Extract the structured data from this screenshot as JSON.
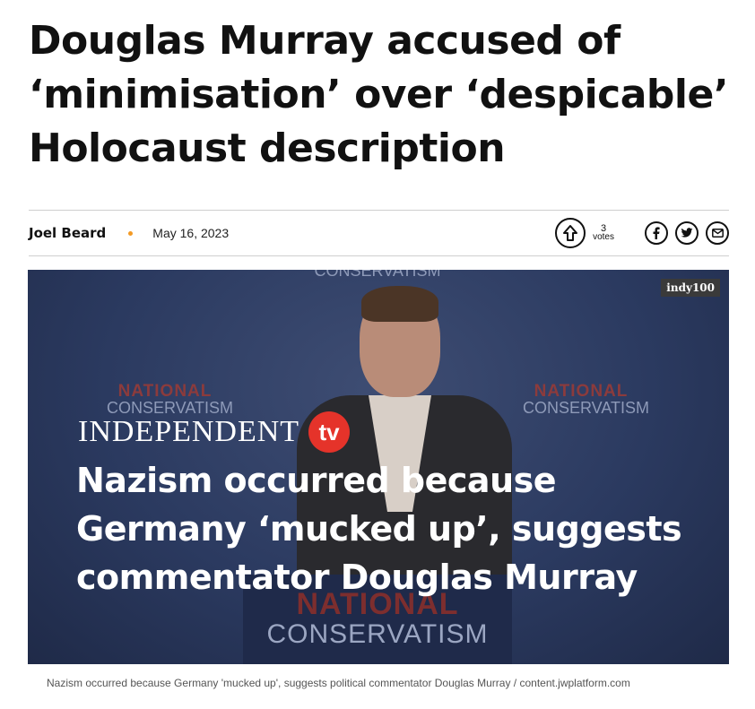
{
  "article": {
    "headline": "Douglas Murray accused of ‘minimisation’ over ‘despicable’ Holocaust description",
    "author": "Joel Beard",
    "date": "May 16, 2023",
    "votes_count": "3",
    "votes_label": "votes"
  },
  "share_icons": [
    "facebook-icon",
    "twitter-icon",
    "email-icon"
  ],
  "media": {
    "badge": "indy100",
    "brand_word": "INDEPENDENT",
    "brand_tv": "tv",
    "overlay_title": "Nazism occurred because Germany ‘mucked up’, suggests commentator Douglas Murray",
    "backdrop_top": "CONSERVATISM",
    "backdrop_line1": "NATIONAL",
    "backdrop_line2": "CONSERVATISM"
  },
  "caption": "Nazism occurred because Germany 'mucked up', suggests political commentator Douglas Murray / content.jwplatform.com",
  "colors": {
    "accent_dot": "#f39a25",
    "tv_red": "#e5332a"
  }
}
